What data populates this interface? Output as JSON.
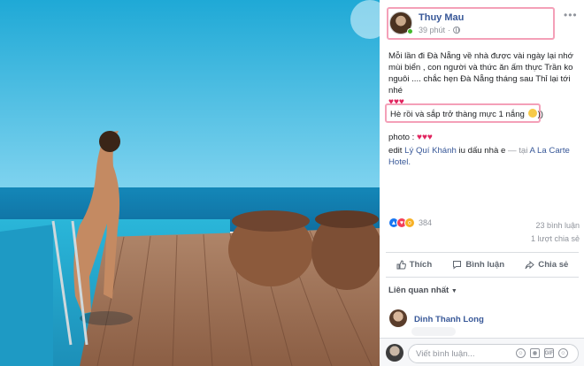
{
  "post": {
    "author": "Thuy Mau",
    "time": "39 phút",
    "text_main": "Mỗi lần đi Đà Nẵng về nhà được vài ngày lại nhớ mùi biển , con người và thức ăn ấm thực Trần ko nguôi .... chắc hẹn Đà Nẵng tháng sau Thỉ lại tới nhé",
    "hearts": "♥♥♥",
    "highlight_text": "Hè rồi và sắp trở thàng mực 1 nắng",
    "highlight_suffix": "))",
    "photo_label": "photo :",
    "photo_hearts": "♥♥♥",
    "edit_prefix": "edit",
    "editor_name": "Lý Quí Khánh",
    "edit_middle": "iu dấu nhà e",
    "location_prefix": "— tại",
    "location": "A La Carte Hotel."
  },
  "stats": {
    "reaction_count": "384",
    "comments": "23 bình luận",
    "shares": "1 lượt chia sẻ"
  },
  "actions": {
    "like": "Thích",
    "comment": "Bình luận",
    "share": "Chia sẻ"
  },
  "comments": {
    "sort_label": "Liên quan nhất",
    "first_commenter": "Dinh Thanh Long"
  },
  "composer": {
    "placeholder": "Viết bình luận..."
  },
  "colors": {
    "link_blue": "#385898",
    "highlight_pink": "#f4a0b8",
    "like_blue": "#1877f2"
  }
}
